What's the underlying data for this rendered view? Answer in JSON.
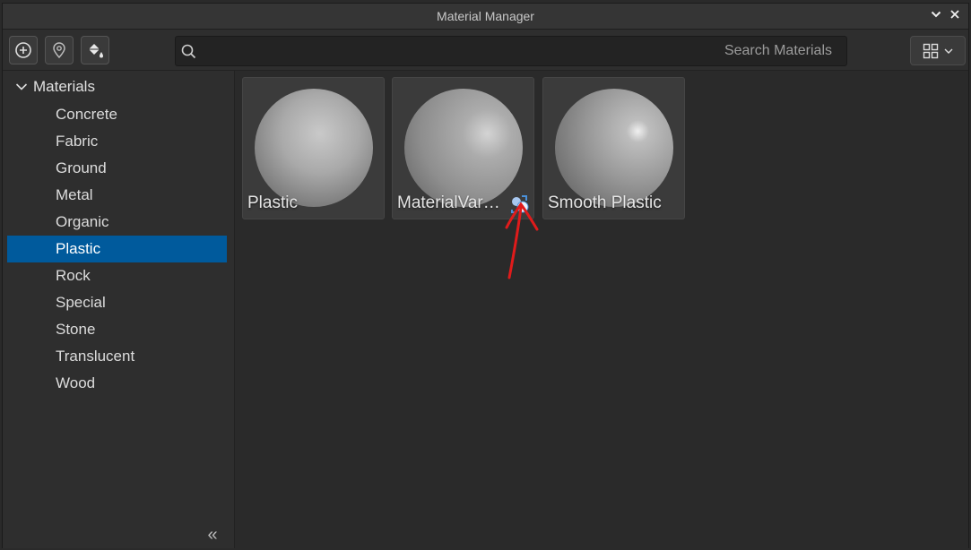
{
  "window": {
    "title": "Material Manager"
  },
  "toolbar": {
    "search_placeholder": "Search Materials",
    "buttons": [
      "add-icon",
      "location-pin-icon",
      "paint-bucket-icon"
    ]
  },
  "sidebar": {
    "root_label": "Materials",
    "items": [
      {
        "label": "Concrete"
      },
      {
        "label": "Fabric"
      },
      {
        "label": "Ground"
      },
      {
        "label": "Metal"
      },
      {
        "label": "Organic"
      },
      {
        "label": "Plastic",
        "selected": true
      },
      {
        "label": "Rock"
      },
      {
        "label": "Special"
      },
      {
        "label": "Stone"
      },
      {
        "label": "Translucent"
      },
      {
        "label": "Wood"
      }
    ],
    "collapse_glyph": "«"
  },
  "materials": [
    {
      "label": "Plastic"
    },
    {
      "label": "MaterialVar…",
      "variant_badge": true
    },
    {
      "label": "Smooth Plastic"
    }
  ],
  "colors": {
    "selection": "#005a9c",
    "annotation": "#e01b1b"
  }
}
